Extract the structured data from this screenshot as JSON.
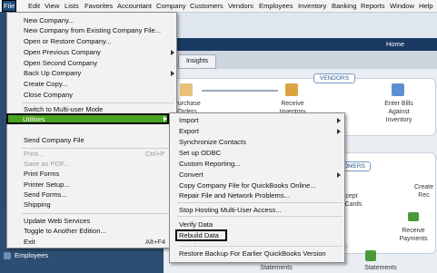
{
  "menubar": {
    "items": [
      "File",
      "Edit",
      "View",
      "Lists",
      "Favorites",
      "Accountant",
      "Company",
      "Customers",
      "Vendors",
      "Employees",
      "Inventory",
      "Banking",
      "Reports",
      "Window",
      "Help"
    ]
  },
  "window": {
    "title": "Home"
  },
  "tabs": {
    "insights": "Insights"
  },
  "home": {
    "vendors_header": "VENDORS",
    "customers_header": "OMERS",
    "purchase_orders": [
      "Purchase",
      "Orders"
    ],
    "receive_inventory": [
      "Receive",
      "Inventory"
    ],
    "enter_bills": [
      "Enter Bills",
      "Against",
      "Inventory"
    ],
    "create_rec": [
      "Create",
      "Rec"
    ],
    "accept_cards": [
      "cept",
      "t Cards"
    ],
    "receive_payments": [
      "Receive",
      "Payments"
    ],
    "statements": "Statements",
    "statements_left": "Statements"
  },
  "left_panel": {
    "employees": "Employees"
  },
  "file_menu": {
    "items": [
      {
        "label": "New Company...",
        "shortcut": "",
        "disabled": false,
        "submenu": false
      },
      {
        "label": "New Company from Existing Company File...",
        "shortcut": "",
        "disabled": false,
        "submenu": false
      },
      {
        "label": "Open or Restore Company...",
        "shortcut": "",
        "disabled": false,
        "submenu": false
      },
      {
        "label": "Open Previous Company",
        "shortcut": "",
        "disabled": false,
        "submenu": true
      },
      {
        "label": "Open Second Company",
        "shortcut": "",
        "disabled": false,
        "submenu": false
      },
      {
        "label": "Back Up Company",
        "shortcut": "",
        "disabled": false,
        "submenu": true
      },
      {
        "label": "Create Copy...",
        "shortcut": "",
        "disabled": false,
        "submenu": false
      },
      {
        "label": "Close Company",
        "shortcut": "",
        "disabled": false,
        "submenu": false
      },
      {
        "label": "Switch to Multi-user Mode",
        "shortcut": "",
        "disabled": false,
        "submenu": false
      },
      {
        "label": "Utilities",
        "shortcut": "",
        "disabled": false,
        "submenu": true
      },
      {
        "label": "Send Company File",
        "shortcut": "",
        "disabled": false,
        "submenu": true
      },
      {
        "label": "Print...",
        "shortcut": "Ctrl+P",
        "disabled": true,
        "submenu": false
      },
      {
        "label": "Save as PDF...",
        "shortcut": "",
        "disabled": true,
        "submenu": false
      },
      {
        "label": "Print Forms",
        "shortcut": "",
        "disabled": false,
        "submenu": true
      },
      {
        "label": "Printer Setup...",
        "shortcut": "",
        "disabled": false,
        "submenu": false
      },
      {
        "label": "Send Forms...",
        "shortcut": "",
        "disabled": false,
        "submenu": false
      },
      {
        "label": "Shipping",
        "shortcut": "",
        "disabled": false,
        "submenu": true
      },
      {
        "label": "Update Web Services",
        "shortcut": "",
        "disabled": false,
        "submenu": false
      },
      {
        "label": "Toggle to Another Edition...",
        "shortcut": "",
        "disabled": false,
        "submenu": false
      },
      {
        "label": "Exit",
        "shortcut": "Alt+F4",
        "disabled": false,
        "submenu": false
      }
    ]
  },
  "utilities_menu": {
    "items": [
      {
        "label": "Import",
        "submenu": true
      },
      {
        "label": "Export",
        "submenu": true
      },
      {
        "label": "Synchronize Contacts",
        "submenu": false
      },
      {
        "label": "Set up ODBC",
        "submenu": false
      },
      {
        "label": "Custom Reporting...",
        "submenu": false
      },
      {
        "label": "Convert",
        "submenu": true
      },
      {
        "label": "Copy Company File for QuickBooks Online...",
        "submenu": false
      },
      {
        "label": "Repair File and Network Problems...",
        "submenu": false
      },
      {
        "label": "Stop Hosting Multi-User Access...",
        "submenu": false
      },
      {
        "label": "Verify Data",
        "submenu": false
      },
      {
        "label": "Rebuild Data",
        "submenu": false
      },
      {
        "label": "Condense Data...",
        "submenu": false
      },
      {
        "label": "Restore Backup For Earlier QuickBooks Version",
        "submenu": false
      }
    ]
  },
  "colors": {
    "highlight": "#4aa31f",
    "titlebar": "#1a3a63",
    "leftpanel": "#2d4d72"
  }
}
